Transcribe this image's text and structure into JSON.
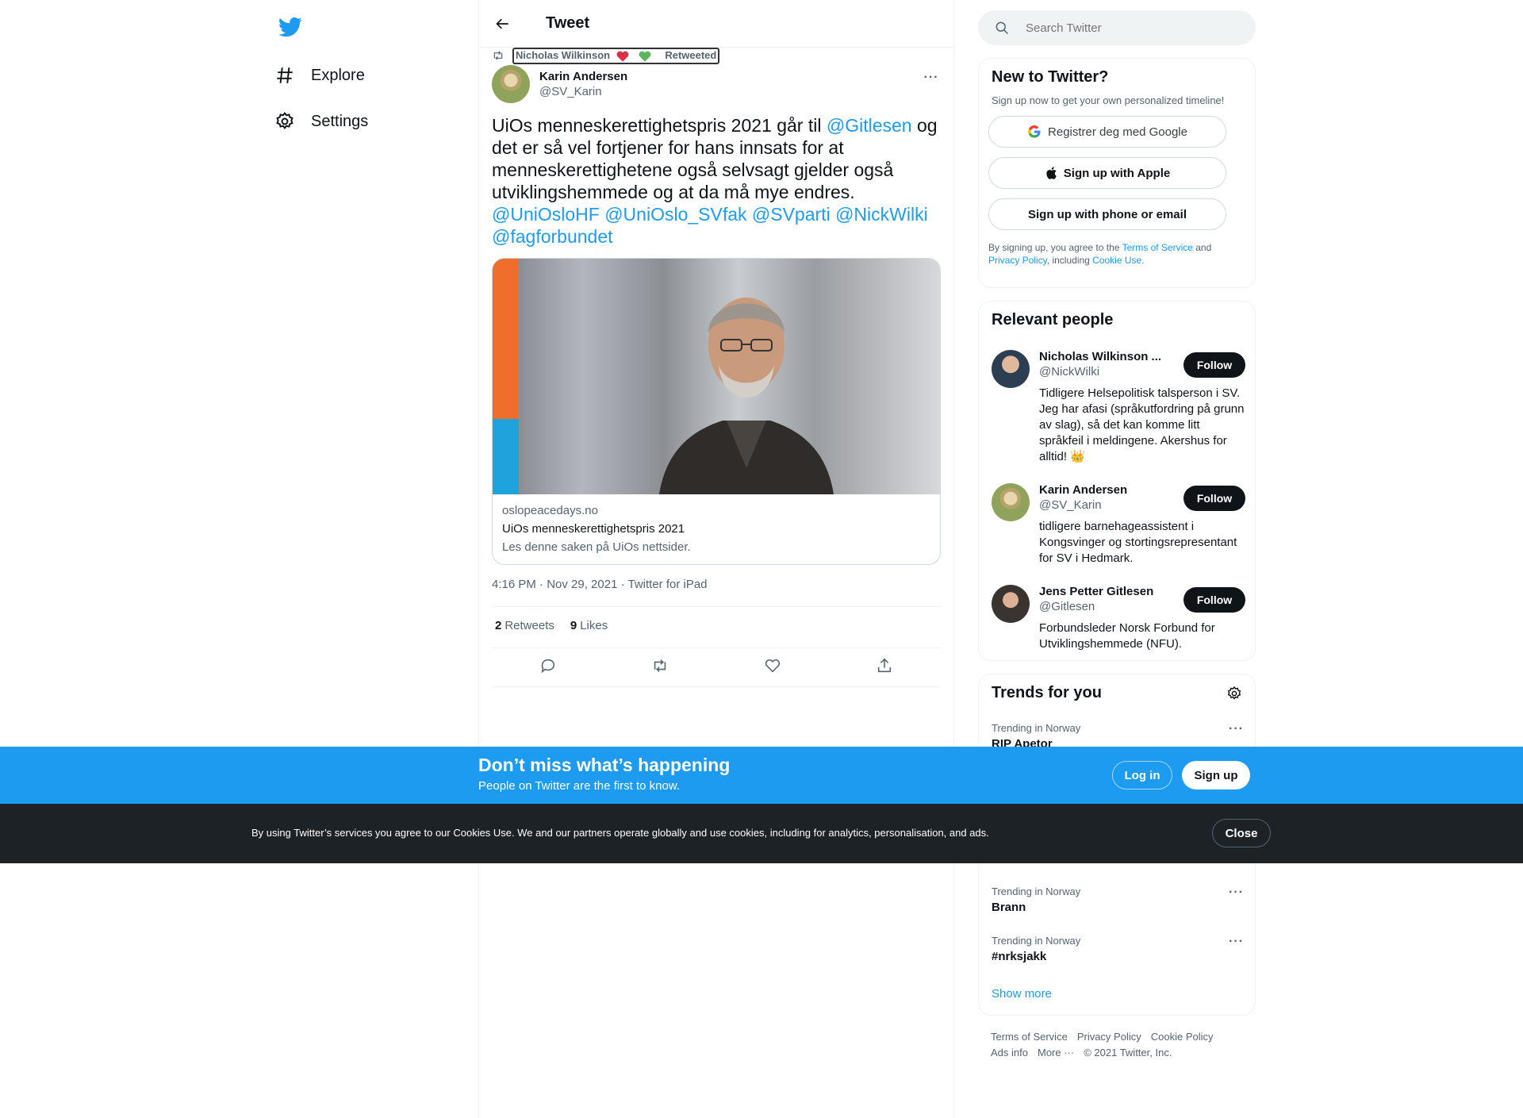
{
  "nav": {
    "logo": "twitter-bird-icon",
    "items": [
      {
        "label": "Explore",
        "icon": "hashtag-icon"
      },
      {
        "label": "Settings",
        "icon": "gear-icon"
      }
    ]
  },
  "header": {
    "title": "Tweet"
  },
  "tweet": {
    "retweeted_by": "Nicholas Wilkinson",
    "retweeted_label": "Retweeted",
    "author_name": "Karin Andersen",
    "author_handle": "@SV_Karin",
    "text_1": "UiOs menneskerettighetspris 2021 går til ",
    "mention_1": "@Gitlesen",
    "text_2": " og det er så vel fortjener for hans innsats for at menneskerettighetene også selvsagt gjelder også utviklingshemmede og at da må mye endres. ",
    "mentions": [
      "@UniOsloHF",
      "@UniOslo_SVfak",
      "@SVparti",
      "@NickWilki",
      "@fagforbundet"
    ],
    "card": {
      "domain": "oslopeacedays.no",
      "title": "UiOs menneskerettighetspris 2021",
      "description": "Les denne saken på UiOs nettsider."
    },
    "timestamp": "4:16 PM · Nov 29, 2021 · Twitter for iPad",
    "retweets_count": "2",
    "retweets_label": "Retweets",
    "likes_count": "9",
    "likes_label": "Likes"
  },
  "search": {
    "placeholder": "Search Twitter"
  },
  "signup": {
    "title": "New to Twitter?",
    "subtitle": "Sign up now to get your own personalized timeline!",
    "google": "Registrer deg med Google",
    "apple": "Sign up with Apple",
    "phone": "Sign up with phone or email",
    "terms_1": "By signing up, you agree to the ",
    "terms_link_1": "Terms of Service",
    "terms_2": " and ",
    "terms_link_2": "Privacy Policy",
    "terms_3": ", including ",
    "terms_link_3": "Cookie Use."
  },
  "people": {
    "title": "Relevant people",
    "follow_label": "Follow",
    "list": [
      {
        "name": "Nicholas Wilkinson ...",
        "handle": "@NickWilki",
        "bio": "Tidligere Helsepolitisk talsperson i SV. Jeg har afasi (språkutfordring på grunn av slag), så det kan komme litt språkfeil i meldingene. Akershus for alltid! 👑"
      },
      {
        "name": "Karin Andersen",
        "handle": "@SV_Karin",
        "bio": "tidligere barnehageassistent i Kongsvinger og stortingsrepresentant for SV i Hedmark."
      },
      {
        "name": "Jens Petter Gitlesen",
        "handle": "@Gitlesen",
        "bio": "Forbundsleder Norsk Forbund for Utviklingshemmede (NFU)."
      }
    ]
  },
  "trends": {
    "title": "Trends for you",
    "items": [
      {
        "meta": "Trending in Norway",
        "name": "RIP Apetor"
      },
      {
        "meta": "Trending in Norway",
        "name": "Brann"
      },
      {
        "meta": "Trending in Norway",
        "name": "#nrksjakk"
      }
    ],
    "show_more": "Show more"
  },
  "footer": {
    "links": [
      "Terms of Service",
      "Privacy Policy",
      "Cookie Policy",
      "Ads info",
      "More ···",
      "© 2021 Twitter, Inc."
    ]
  },
  "banner": {
    "title": "Don’t miss what’s happening",
    "subtitle": "People on Twitter are the first to know.",
    "login": "Log in",
    "signup": "Sign up"
  },
  "cookie": {
    "text": "By using Twitter’s services you agree to our Cookies Use. We and our partners operate globally and use cookies, including for analytics, personalisation, and ads.",
    "close": "Close"
  },
  "colors": {
    "accent": "#1d9bf0",
    "dark": "#0f1419",
    "muted": "#536471",
    "cookie_bg": "#1d2226"
  }
}
